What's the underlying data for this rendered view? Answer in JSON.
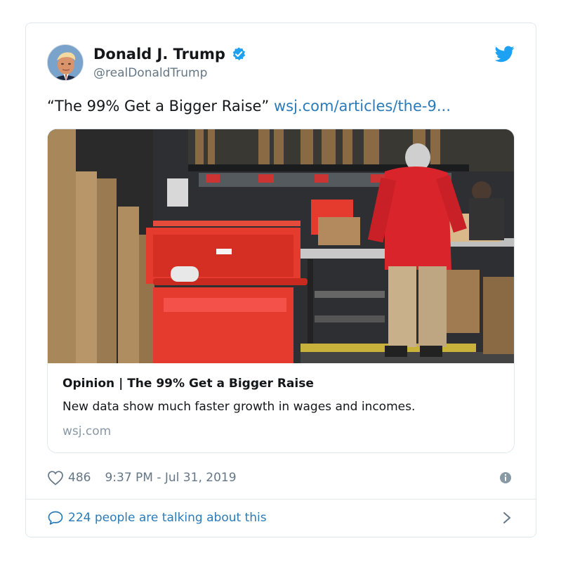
{
  "author": {
    "display_name": "Donald J. Trump",
    "handle": "@realDonaldTrump",
    "verified": true,
    "avatar_icon": "profile-photo"
  },
  "tweet": {
    "text": "“The 99% Get a Bigger Raise”",
    "link_text": "wsj.com/articles/the-9..."
  },
  "link_card": {
    "image_icon": "warehouse-photo",
    "title": "Opinion | The 99% Get a Bigger Raise",
    "description": "New data show much faster growth in wages and incomes.",
    "domain": "wsj.com"
  },
  "meta": {
    "likes": "486",
    "timestamp": "9:37 PM - Jul 31, 2019"
  },
  "footer": {
    "talking_text": "224 people are talking about this"
  },
  "colors": {
    "link_blue": "#2b7bb9",
    "twitter_blue": "#1da1f2",
    "secondary_text": "#657786",
    "border": "#e1e8ed"
  },
  "icons": [
    "twitter-bird-icon",
    "verified-badge-icon",
    "heart-icon",
    "info-icon",
    "speech-bubble-icon",
    "chevron-right-icon"
  ]
}
